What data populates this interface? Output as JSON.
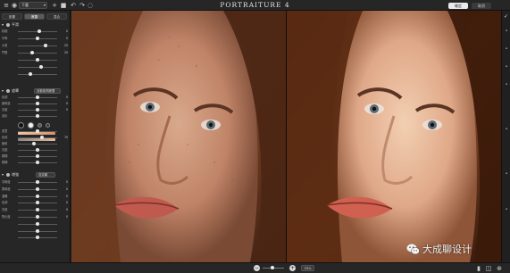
{
  "titlebar": {
    "app_title": "PORTRAITURE 4",
    "preset_value": "下載",
    "ok_label": "確定",
    "cancel_label": "取消"
  },
  "panel": {
    "tabs": [
      "設置",
      "遮罩",
      "混合"
    ],
    "active_tab": 1,
    "sections": [
      {
        "title": "平滑",
        "select": ""
      },
      {
        "title": "遮罩",
        "select": "自動檢測遮罩"
      },
      {
        "title": "增強",
        "select": "自定義"
      }
    ],
    "smoothing_rows": [
      {
        "label": "精細",
        "value": "0",
        "pos": 0.55
      },
      {
        "label": "中等",
        "value": "0",
        "pos": 0.5
      },
      {
        "label": "大型",
        "value": "20",
        "pos": 0.72
      },
      {
        "label": "門限",
        "value": "20",
        "pos": 0.35
      },
      {
        "label": "",
        "value": "",
        "pos": 0.5
      },
      {
        "label": "",
        "value": "",
        "pos": 0.6
      },
      {
        "label": "",
        "value": "",
        "pos": 0.3
      }
    ],
    "mask_rows": [
      {
        "label": "色調",
        "value": "0",
        "pos": 0.5
      },
      {
        "label": "飽和度",
        "value": "0",
        "pos": 0.5
      },
      {
        "label": "亮度",
        "value": "0",
        "pos": 0.5
      },
      {
        "label": "羽化",
        "value": "",
        "pos": 0.5
      }
    ],
    "mask_rows2": [
      {
        "label": "遮罩",
        "value": "",
        "pos": 0.5
      },
      {
        "label": "色域",
        "value": "70",
        "pos": 0.62
      },
      {
        "label": "飽和",
        "value": "",
        "pos": 0.4
      },
      {
        "label": "亮度",
        "value": "",
        "pos": 0.5
      },
      {
        "label": "模糊",
        "value": "",
        "pos": 0.5
      },
      {
        "label": "模糊",
        "value": "",
        "pos": 0.5
      }
    ],
    "enhance_rows": [
      {
        "label": "清晰度",
        "value": "0",
        "pos": 0.5
      },
      {
        "label": "柔和度",
        "value": "0",
        "pos": 0.5
      },
      {
        "label": "溫暖",
        "value": "0",
        "pos": 0.5
      },
      {
        "label": "色調",
        "value": "0",
        "pos": 0.5
      },
      {
        "label": "亮度",
        "value": "0",
        "pos": 0.5
      },
      {
        "label": "對比度",
        "value": "0",
        "pos": 0.5
      },
      {
        "label": "",
        "value": "",
        "pos": 0.5
      },
      {
        "label": "",
        "value": "",
        "pos": 0.5
      },
      {
        "label": "",
        "value": "",
        "pos": 0.5
      }
    ]
  },
  "statusbar": {
    "zoom_value": "33%"
  },
  "watermark": {
    "text": "大成聊设计"
  },
  "colors": {
    "accent": "#eaeaea",
    "panel_bg": "#262626",
    "skin_swatch": "#e6b89a"
  },
  "icons": [
    "menu-icon",
    "undo-icon",
    "redo-icon",
    "zoom-out-icon",
    "zoom-in-icon",
    "single-view-icon",
    "split-view-icon",
    "globe-icon"
  ]
}
